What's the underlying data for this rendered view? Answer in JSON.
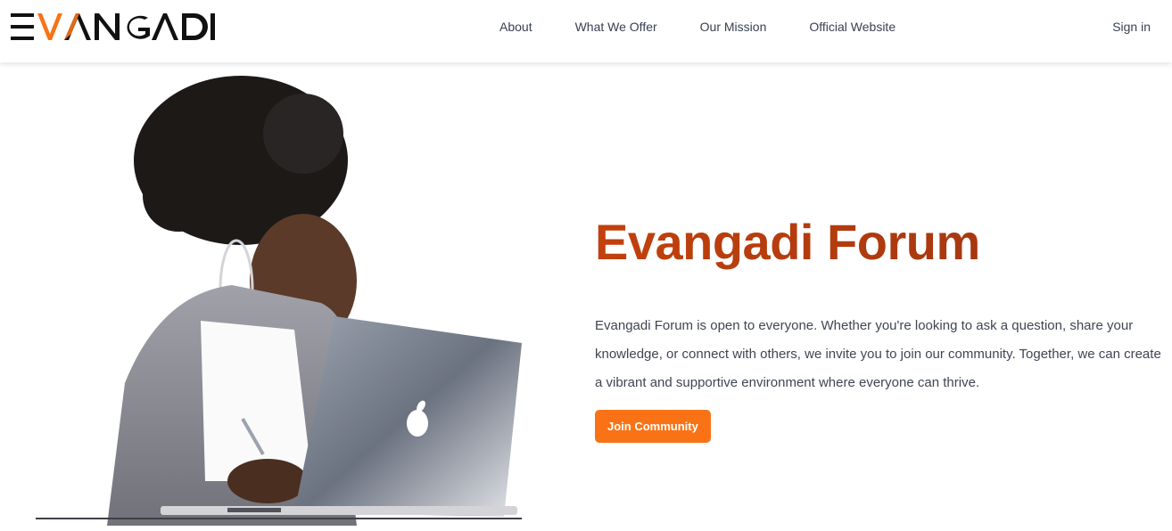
{
  "brand": {
    "logo_text": "EVANGADI",
    "accent_color": "#f97316",
    "title_gradient": [
      "#c2410c",
      "#9a3412"
    ]
  },
  "nav": {
    "links": [
      "About",
      "What We Offer",
      "Our Mission",
      "Official Website"
    ],
    "signin_label": "Sign in"
  },
  "hero": {
    "title": "Evangadi Forum",
    "description": "Evangadi Forum is open to everyone. Whether you're looking to ask a question, share your knowledge, or connect with others, we invite you to join our community. Together, we can create a vibrant and supportive environment where everyone can thrive.",
    "cta_label": "Join Community",
    "illustration": "woman-with-laptop-illustration"
  }
}
